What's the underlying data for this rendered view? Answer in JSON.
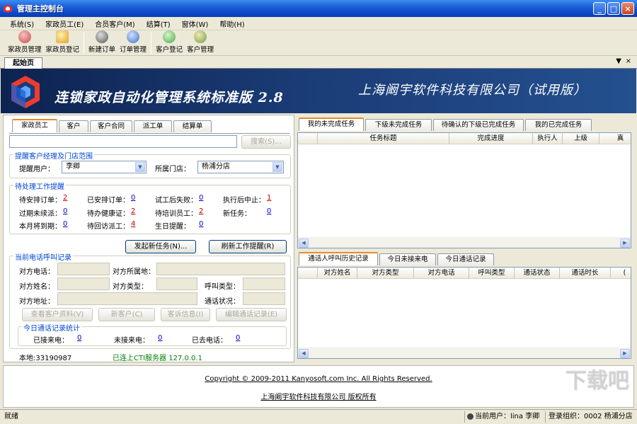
{
  "window": {
    "title": "管理主控制台"
  },
  "menu": [
    "系统(S)",
    "家政员工(E)",
    "合员客户(M)",
    "结算(T)",
    "窗体(W)",
    "帮助(H)"
  ],
  "toolbar": [
    {
      "label": "家政员管理",
      "icon": "people-icon",
      "color": "#c84a4a"
    },
    {
      "label": "家政员登记",
      "icon": "register-icon",
      "color": "#e0a020"
    },
    {
      "label": "新建订单",
      "icon": "disk-icon",
      "color": "#555555"
    },
    {
      "label": "订单管理",
      "icon": "order-icon",
      "color": "#3d74c6"
    },
    {
      "label": "客户登记",
      "icon": "customer-icon",
      "color": "#4aa84a"
    },
    {
      "label": "客户管理",
      "icon": "customers-icon",
      "color": "#6aa04a"
    }
  ],
  "doc_tab": "起始页",
  "banner": {
    "product": "连锁家政自动化管理系统标准版 2.8",
    "company": "上海阚宇软件科技有限公司（试用版）"
  },
  "left": {
    "tabs": [
      "家政员工",
      "客户",
      "客户合同",
      "派工单",
      "结算单"
    ],
    "search_button": "搜索(S)...",
    "scope_title": "提醒客户经理及门店范围",
    "remind_user_label": "提醒用户：",
    "remind_user_value": "李卿",
    "store_label": "所属门店：",
    "store_value": "杨浦分店",
    "pending_title": "待处理工作提醒",
    "pending": [
      {
        "label": "待安排订单：",
        "value": "2",
        "red": true
      },
      {
        "label": "已安排订单：",
        "value": "0",
        "red": false
      },
      {
        "label": "试工后失败：",
        "value": "0",
        "red": false
      },
      {
        "label": "执行后中止：",
        "value": "1",
        "red": true
      },
      {
        "label": "过期未续派：",
        "value": "0",
        "red": false
      },
      {
        "label": "待办健康证：",
        "value": "2",
        "red": true
      },
      {
        "label": "待培训员工：",
        "value": "2",
        "red": true
      },
      {
        "label": "新任务：",
        "value": "0",
        "red": false
      },
      {
        "label": "本月将到期：",
        "value": "0",
        "red": false
      },
      {
        "label": "待回访派工：",
        "value": "4",
        "red": true
      },
      {
        "label": "生日提醒：",
        "value": "0",
        "red": false
      }
    ],
    "new_task_button": "发起新任务(N)...",
    "refresh_button": "刷新工作提醒(R)",
    "call_title": "当前电话呼叫记录",
    "call_fields": {
      "phone": "对方电话：",
      "location": "对方所属地：",
      "name": "对方姓名：",
      "type": "对方类型：",
      "call_type": "呼叫类型：",
      "address": "对方地址：",
      "status": "通话状况："
    },
    "call_buttons": [
      "查看客户资料(V)",
      "新客户(C)",
      "客诉信息(I)",
      "编辑通话记录(E)"
    ],
    "stats_title": "今日通话记录统计",
    "stats": [
      {
        "label": "已接来电：",
        "value": "0"
      },
      {
        "label": "未接来电：",
        "value": "0"
      },
      {
        "label": "已去电话：",
        "value": "0"
      }
    ],
    "local_number": "本地:33190987",
    "cti_status": "已连上CTI服务器 127.0.0.1"
  },
  "right": {
    "task_tabs": [
      "我的未完成任务",
      "下级未完成任务",
      "待确认的下级已完成任务",
      "我的已完成任务"
    ],
    "task_columns": [
      "",
      "任务标题",
      "完成进度",
      "执行人",
      "上级",
      "真"
    ],
    "call_tabs": [
      "通话人呼叫历史记录",
      "今日未接来电",
      "今日通话记录"
    ],
    "call_columns": [
      "",
      "对方姓名",
      "对方类型",
      "对方电话",
      "呼叫类型",
      "通话状态",
      "通话时长",
      "("
    ]
  },
  "footer": {
    "copyright": "Copyright © 2009-2011 Kanyosoft.com Inc. All Rights Reserved.",
    "owner": "上海阚宇软件科技有限公司 版权所有"
  },
  "status": {
    "ready": "就绪",
    "current_user": "当前用户：lina 李卿",
    "login_org": "登录组织：0002 杨浦分店"
  },
  "watermark": "下载吧"
}
